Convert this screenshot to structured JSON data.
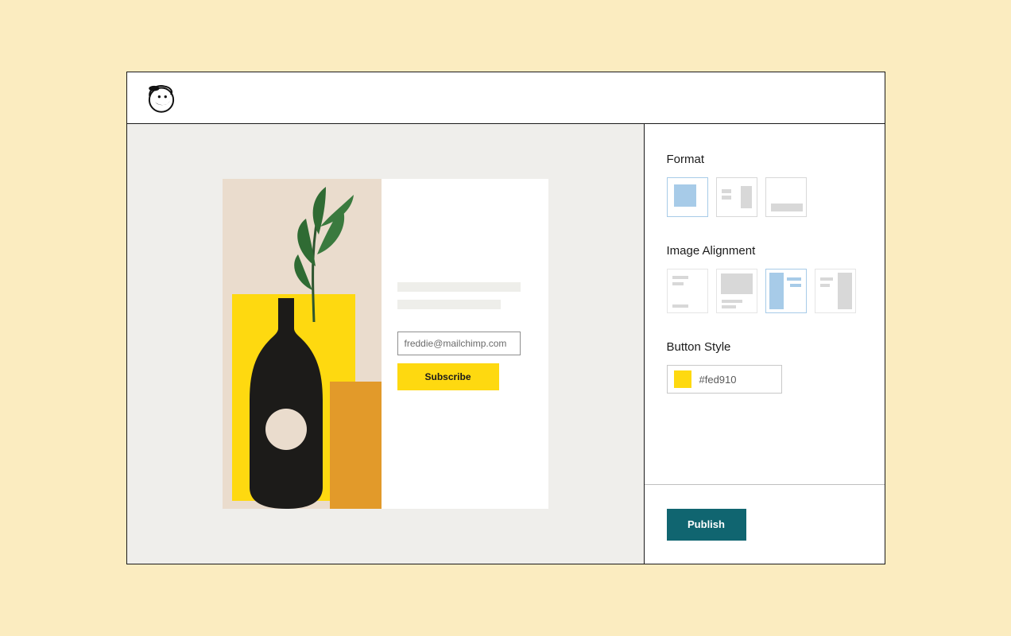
{
  "brand": {
    "name": "Mailchimp"
  },
  "preview": {
    "email_value": "freddie@mailchimp.com",
    "subscribe_label": "Subscribe"
  },
  "sidebar": {
    "format": {
      "label": "Format",
      "options": [
        "single-image",
        "image-right",
        "image-bottom"
      ],
      "selected_index": 0
    },
    "image_alignment": {
      "label": "Image Alignment",
      "options": [
        "top-left-text",
        "top-image",
        "left-image",
        "right-image"
      ],
      "selected_index": 2
    },
    "button_style": {
      "label": "Button Style",
      "color": "#fed910"
    },
    "publish_label": "Publish"
  }
}
